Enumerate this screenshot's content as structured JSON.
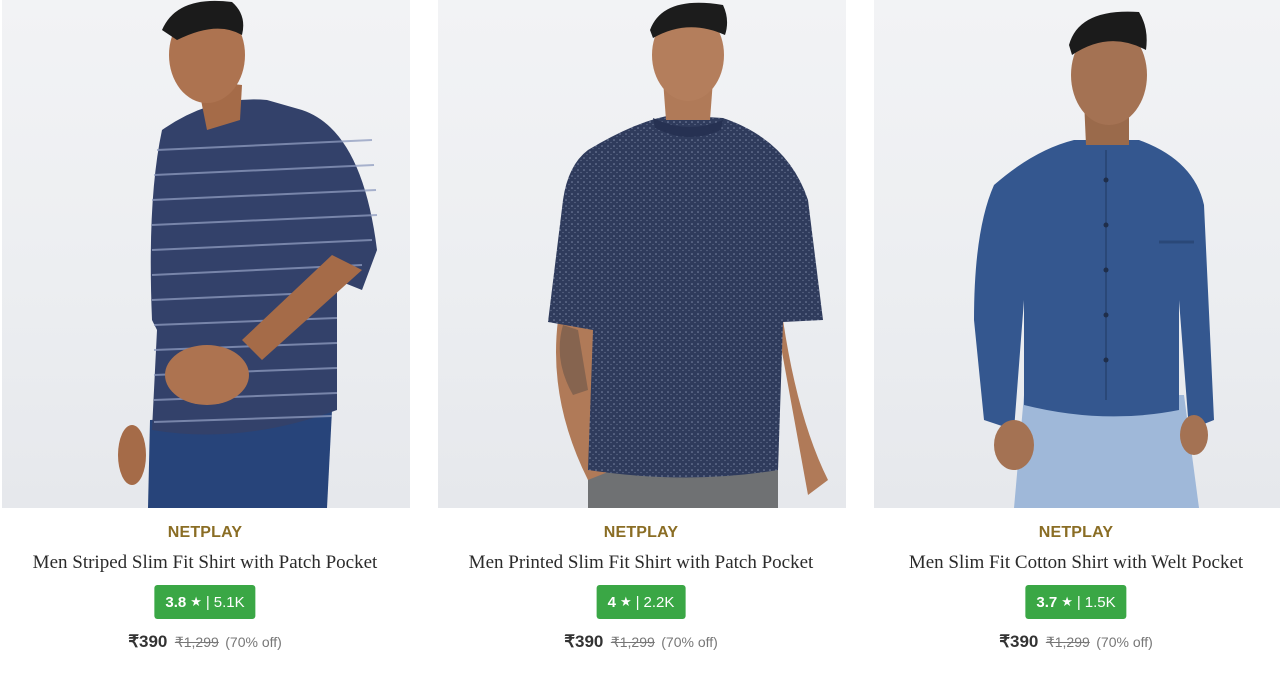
{
  "products": [
    {
      "brand": "NETPLAY",
      "title": "Men Striped Slim Fit Shirt with Patch Pocket",
      "rating": "3.8",
      "rating_star": "★",
      "rating_sep": "|",
      "reviews": "5.1K",
      "price": "₹390",
      "mrp": "₹1,299",
      "discount": "(70% off)",
      "shirt_color": "#33416a",
      "pattern": "striped"
    },
    {
      "brand": "NETPLAY",
      "title": "Men Printed Slim Fit Shirt with Patch Pocket",
      "rating": "4",
      "rating_star": "★",
      "rating_sep": "|",
      "reviews": "2.2K",
      "price": "₹390",
      "mrp": "₹1,299",
      "discount": "(70% off)",
      "shirt_color": "#2f3b5c",
      "pattern": "printed"
    },
    {
      "brand": "NETPLAY",
      "title": "Men Slim Fit Cotton Shirt with Welt Pocket",
      "rating": "3.7",
      "rating_star": "★",
      "rating_sep": "|",
      "reviews": "1.5K",
      "price": "₹390",
      "mrp": "₹1,299",
      "discount": "(70% off)",
      "shirt_color": "#34578f",
      "pattern": "solid"
    }
  ],
  "colors": {
    "brand_text": "#8a6d24",
    "rating_badge": "#3aa745"
  }
}
